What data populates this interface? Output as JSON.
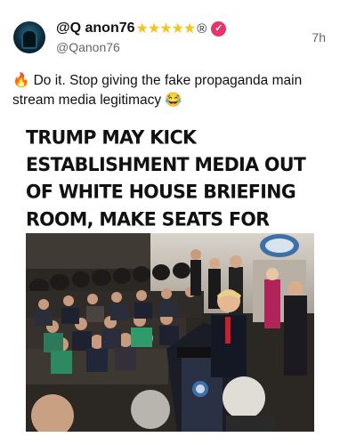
{
  "post": {
    "display_name": "@Q anon76",
    "stars": "★★★★★",
    "registered_mark": "®",
    "verified_glyph": "✓",
    "handle": "@Qanon76",
    "timestamp": "7h",
    "text": "🔥 Do it. Stop giving the fake propaganda main stream media legitimacy 😂",
    "headline": "TRUMP MAY KICK ESTABLISHMENT MEDIA OUT OF WHITE HOUSE BRIEFING ROOM, MAKE SEATS FOR NEW MEDIA"
  },
  "icons": {
    "avatar": "hooded-figure-avatar",
    "verified": "verified-badge-icon"
  },
  "colors": {
    "star": "#f5c518",
    "verified_badge": "#e8336b",
    "secondary_text": "#666666",
    "podium_seal": "#3d6fa8"
  }
}
